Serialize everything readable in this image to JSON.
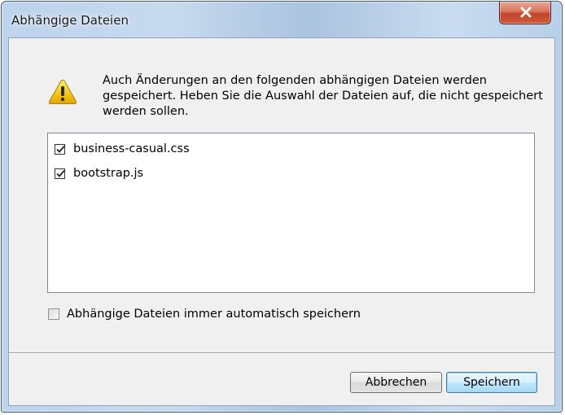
{
  "window": {
    "title": "Abhängige Dateien",
    "close_symbol": "x"
  },
  "icon": "warning-icon",
  "message": "Auch Änderungen an den folgenden abhängigen Dateien werden gespeichert. Heben Sie die Auswahl der Dateien auf, die nicht gespeichert werden sollen.",
  "files": [
    {
      "name": "business-casual.css",
      "checked": true
    },
    {
      "name": "bootstrap.js",
      "checked": true
    }
  ],
  "auto_save": {
    "label": "Abhängige Dateien immer automatisch speichern",
    "checked": false
  },
  "buttons": {
    "cancel": "Abbrechen",
    "save": "Speichern"
  },
  "colors": {
    "title_bar": "#bcd3ec",
    "close_button": "#c2432a",
    "dialog_background": "#f0f0f0",
    "default_button_border": "#3c7fb1"
  }
}
